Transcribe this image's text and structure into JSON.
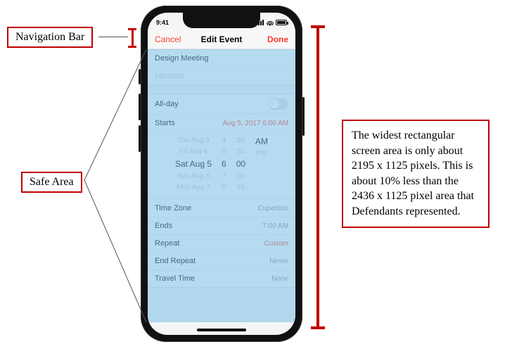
{
  "callouts": {
    "nav_label": "Navigation Bar",
    "safe_label": "Safe Area",
    "right_text": "The widest rectangular screen area is only about 2195 x 1125 pixels. This is about 10% less than the 2436 x 1125 pixel area that Defendants represented."
  },
  "status": {
    "time": "9:41"
  },
  "nav": {
    "cancel": "Cancel",
    "title": "Edit Event",
    "done": "Done"
  },
  "event": {
    "title": "Design Meeting",
    "location_placeholder": "Location"
  },
  "allday": {
    "label": "All-day"
  },
  "starts": {
    "label": "Starts",
    "value": "Aug 5, 2017   6:00 AM"
  },
  "picker": {
    "r1": {
      "d": "Thu Aug 3",
      "h": "4",
      "m": "50",
      "ap": ""
    },
    "r2": {
      "d": "Fri Aug 4",
      "h": "5",
      "m": "55",
      "ap": ""
    },
    "sel": {
      "d": "Sat Aug 5",
      "h": "6",
      "m": "00",
      "ap": "AM"
    },
    "r4": {
      "d": "Sun Aug 6",
      "h": "7",
      "m": "05",
      "ap": "PM"
    },
    "r5": {
      "d": "Mon Aug 7",
      "h": "8",
      "m": "10",
      "ap": ""
    }
  },
  "tz": {
    "label": "Time Zone",
    "value": "Cupertino"
  },
  "ends": {
    "label": "Ends",
    "value": "7:00 AM"
  },
  "repeat": {
    "label": "Repeat",
    "value": "Custom"
  },
  "endrepeat": {
    "label": "End Repeat",
    "value": "Never"
  },
  "travel": {
    "label": "Travel Time",
    "value": "None"
  }
}
